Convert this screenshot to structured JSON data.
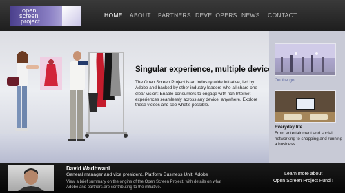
{
  "logo": {
    "line1": "open",
    "line2": "screen",
    "line3": "project"
  },
  "nav": {
    "items": [
      {
        "label": "HOME",
        "active": true
      },
      {
        "label": "ABOUT",
        "active": false
      },
      {
        "label": "PARTNERS",
        "active": false
      },
      {
        "label": "DEVELOPERS",
        "active": false
      },
      {
        "label": "NEWS",
        "active": false
      },
      {
        "label": "CONTACT",
        "active": false
      }
    ]
  },
  "hero": {
    "title": "Singular experience, multiple devices",
    "body": "The Open Screen Project is an industry-wide initiative, led by Adobe and backed by other industry leaders who all share one clear vision: Enable consumers to engage with rich Internet experiences seamlessly across any device, anywhere. Explore these videos and see what’s possible."
  },
  "side": {
    "items": [
      {
        "caption": "On the go",
        "description": ""
      },
      {
        "caption": "Everyday life",
        "description": "From entertainment and social networking to shopping and running a business."
      }
    ]
  },
  "bottom": {
    "name": "David Wadhwani",
    "title": "General manager and vice president, Platform Business Unit, Adobe",
    "description": "View a brief summary on the origins of the Open Screen Project, with details on what Adobe and partners are contributing to the initiative.",
    "link_line1": "Learn more about",
    "link_line2": "Open Screen Project Fund ›"
  },
  "colors": {
    "accent_caption": "#5f6aa3",
    "header_bg": "#2b2b2b"
  }
}
